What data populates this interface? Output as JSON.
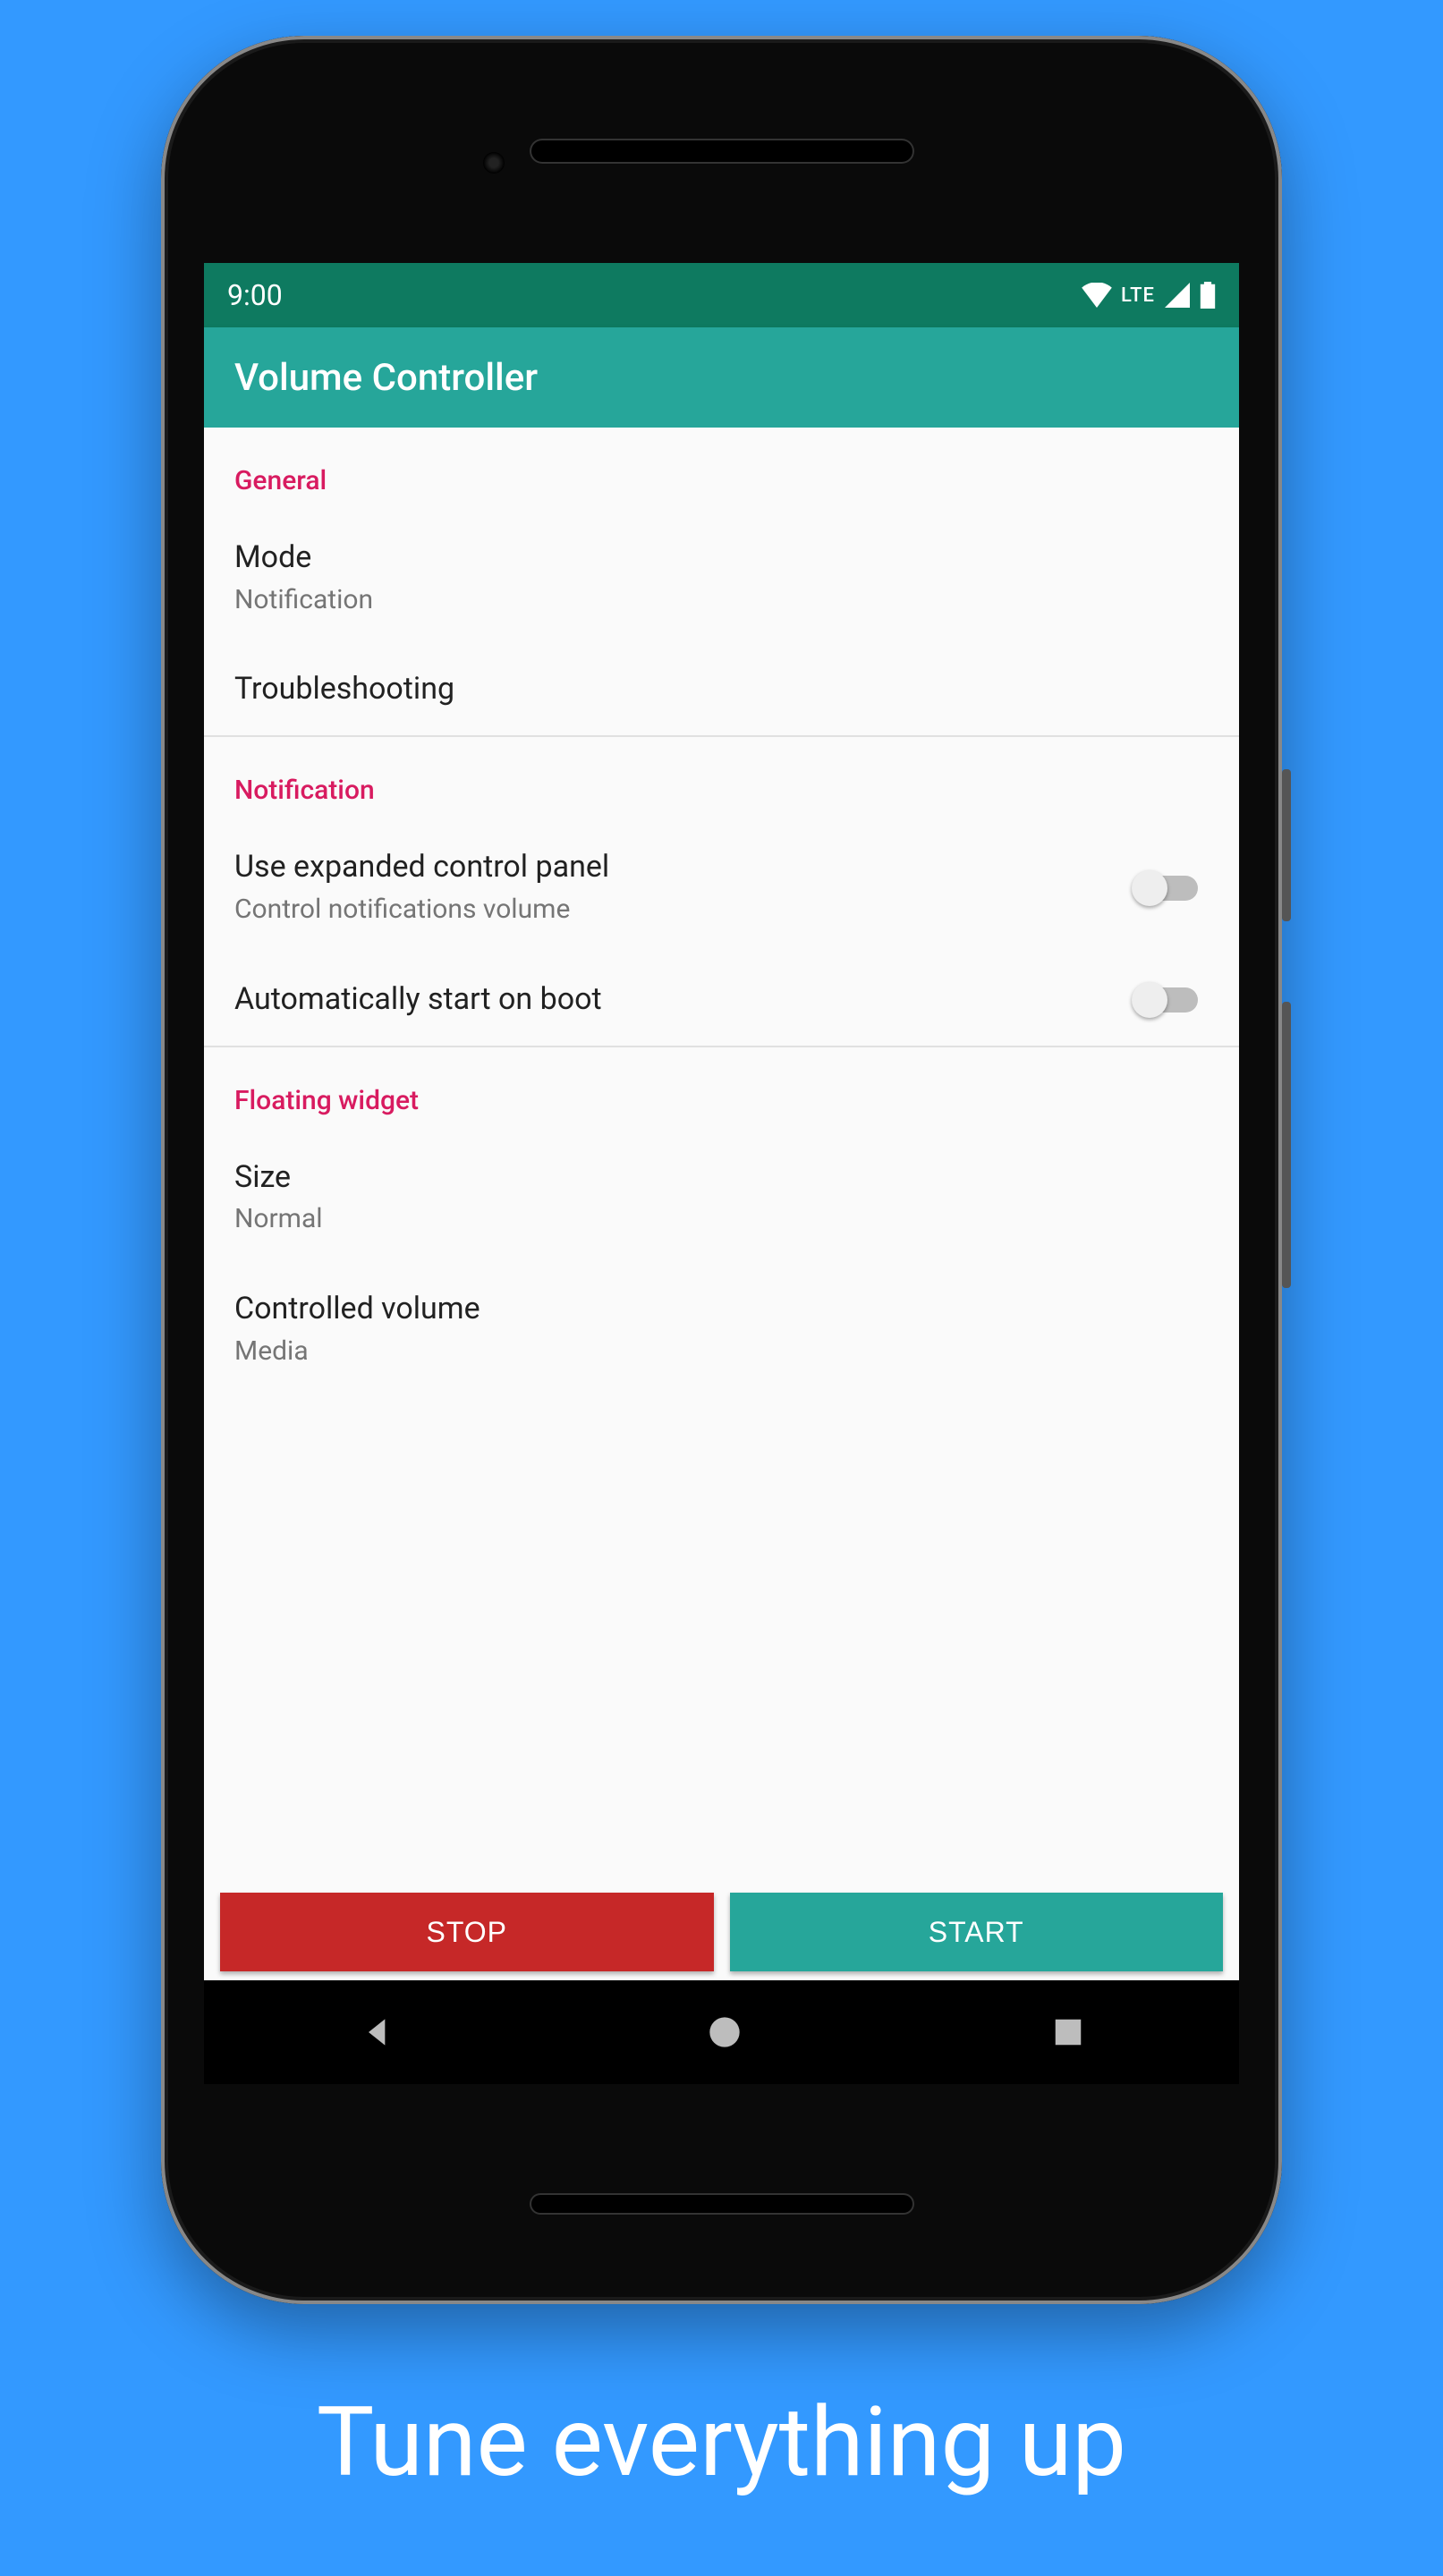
{
  "statusbar": {
    "time": "9:00",
    "lte": "LTE"
  },
  "appbar": {
    "title": "Volume Controller"
  },
  "sections": {
    "general": {
      "header": "General",
      "mode": {
        "title": "Mode",
        "summary": "Notification"
      },
      "troubleshooting": {
        "title": "Troubleshooting"
      }
    },
    "notification": {
      "header": "Notification",
      "expanded": {
        "title": "Use expanded control panel",
        "summary": "Control notifications volume"
      },
      "boot": {
        "title": "Automatically start on boot"
      }
    },
    "floating": {
      "header": "Floating widget",
      "size": {
        "title": "Size",
        "summary": "Normal"
      },
      "controlled": {
        "title": "Controlled volume",
        "summary": "Media"
      }
    }
  },
  "buttons": {
    "stop": "STOP",
    "start": "START"
  },
  "caption": "Tune everything up"
}
